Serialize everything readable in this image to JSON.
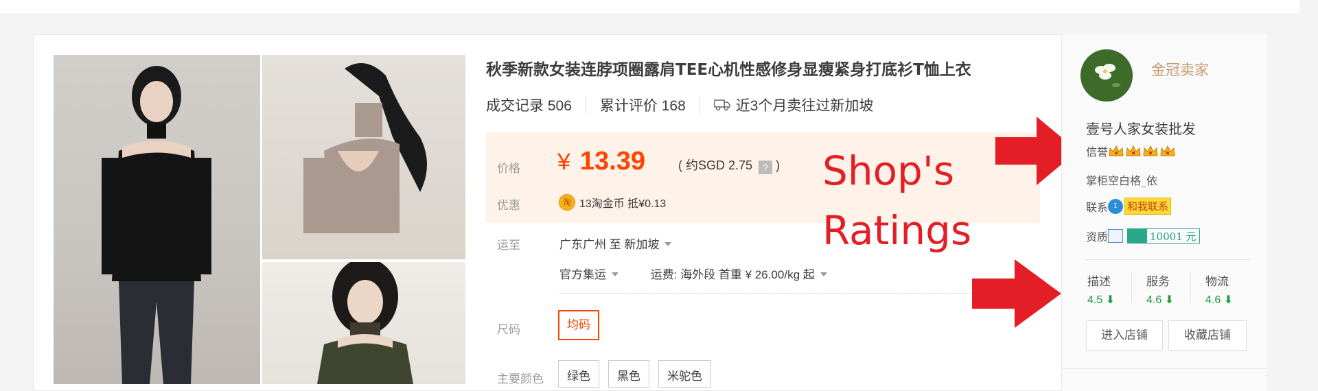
{
  "product": {
    "title": "秋季新款女装连脖项圈露肩TEE心机性感修身显瘦紧身打底衫T恤上衣",
    "sales_label": "成交记录 506",
    "reviews_label": "累计评价 168",
    "sold_to_label": "近3个月卖往过新加坡"
  },
  "price": {
    "label": "价格",
    "currency": "¥",
    "value": "13.39",
    "approx": "( 约SGD 2.75",
    "approx_help": "?",
    "approx_close": ")",
    "promo_label": "优惠",
    "coin_icon_text": "淘",
    "promo_text": "13淘金币 抵¥0.13"
  },
  "shipping": {
    "label": "运至",
    "route": "广东广州 至  新加坡",
    "method": "官方集运",
    "fee": "运费: 海外段 首重 ¥ 26.00/kg 起"
  },
  "size": {
    "label": "尺码",
    "option": "均码"
  },
  "colors": {
    "label": "主要颜色",
    "options": [
      "绿色",
      "黑色",
      "米驼色"
    ]
  },
  "annotation": {
    "line1": "Shop's",
    "line2": "Ratings",
    "color": "#e41e26"
  },
  "seller": {
    "type": "金冠卖家",
    "shop_name": "壹号人家女装批发",
    "credit_label": "信誉",
    "keeper_label": "掌柜",
    "keeper_name": "空白格_依",
    "contact_label": "联系",
    "contact_button": "和我联系",
    "qual_label": "资质",
    "deposit": "10001 元"
  },
  "ratings": [
    {
      "label": "描述",
      "value": "4.5"
    },
    {
      "label": "服务",
      "value": "4.6"
    },
    {
      "label": "物流",
      "value": "4.6"
    }
  ],
  "shop_buttons": {
    "enter": "进入店铺",
    "favorite": "收藏店铺"
  },
  "colors_theme": {
    "price": "#ff4400",
    "price_bg": "#fff2e8",
    "rating_green": "#1c9a41",
    "seller_gold": "#c69a70"
  }
}
